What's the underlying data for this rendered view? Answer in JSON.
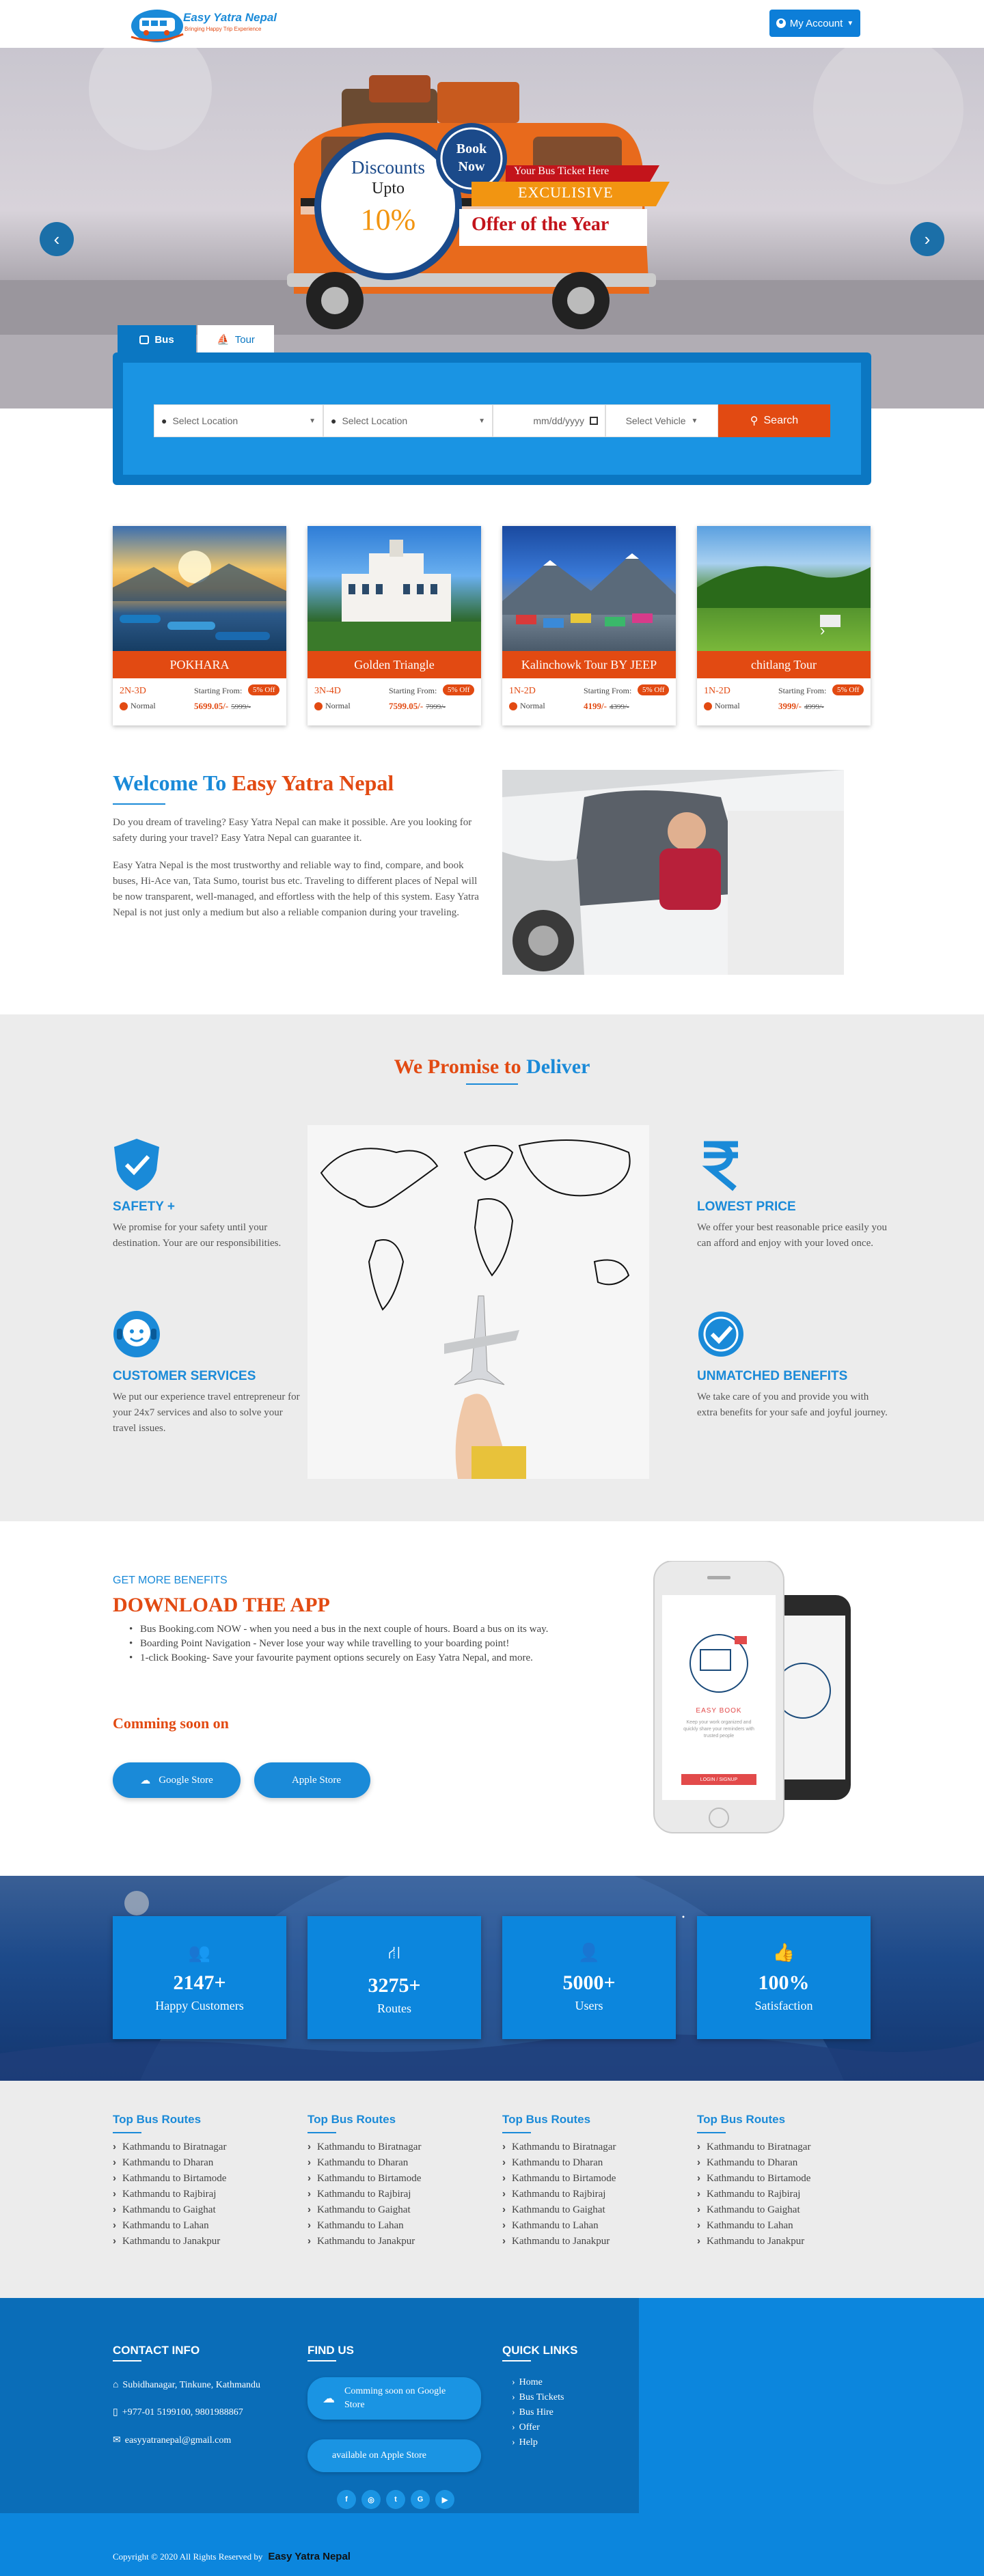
{
  "header": {
    "brand": "Easy Yatra Nepal",
    "tagline": "Bringing Happy Trip Experience",
    "account_label": "My Account"
  },
  "hero": {
    "discount_title": "Discounts",
    "discount_upto": "Upto",
    "discount_value": "10%",
    "book_now_1": "Book",
    "book_now_2": "Now",
    "ribbon_1": "Your Bus Ticket Here",
    "ribbon_2": "EXCULISIVE",
    "ribbon_3": "Offer of the Year"
  },
  "search": {
    "tabs": [
      {
        "label": "Bus"
      },
      {
        "label": "Tour"
      }
    ],
    "from_placeholder": "Select Location",
    "to_placeholder": "Select Location",
    "date_placeholder": "mm/dd/yyyy",
    "vehicle_placeholder": "Select Vehicle",
    "button_label": "Search"
  },
  "tours": [
    {
      "name": "POKHARA",
      "days": "2N-3D",
      "starting": "Starting From:",
      "off": "5% Off",
      "category": "Normal",
      "price": "5699.05/-",
      "old_price": "5999/-"
    },
    {
      "name": "Golden Triangle",
      "days": "3N-4D",
      "starting": "Starting From:",
      "off": "5% Off",
      "category": "Normal",
      "price": "7599.05/-",
      "old_price": "7999/-"
    },
    {
      "name": "Kalinchowk Tour BY JEEP",
      "days": "1N-2D",
      "starting": "Starting From:",
      "off": "5% Off",
      "category": "Normal",
      "price": "4199/-",
      "old_price": "4399/-"
    },
    {
      "name": "chitlang Tour",
      "days": "1N-2D",
      "starting": "Starting From:",
      "off": "5% Off",
      "category": "Normal",
      "price": "3999/-",
      "old_price": "4999/-"
    }
  ],
  "welcome": {
    "title_1": "Welcome To ",
    "title_2": "Easy Yatra Nepal",
    "para_1": "Do you dream of traveling? Easy Yatra Nepal can make it possible. Are you looking for safety during your travel? Easy Yatra Nepal can guarantee it.",
    "para_2": "Easy Yatra Nepal is the most trustworthy and reliable way to find, compare, and book buses, Hi-Ace van, Tata Sumo, tourist bus etc. Traveling to different places of Nepal will be now transparent, well-managed, and effortless with the help of this system. Easy Yatra Nepal is not just only a medium but also a reliable companion during your traveling."
  },
  "promise": {
    "title_1": "We Promise to ",
    "title_2": "Deliver",
    "features": [
      {
        "title": "SAFETY +",
        "text": "We promise for your safety until your destination. Your are our responsibilities."
      },
      {
        "title": "CUSTOMER SERVICES",
        "text": "We put our experience travel entrepreneur for your 24x7 services and also to solve your travel issues."
      },
      {
        "title": "LOWEST PRICE",
        "text": "We offer your best reasonable price easily you can afford and enjoy with your loved once."
      },
      {
        "title": "UNMATCHED BENEFITS",
        "text": "We take care of you and provide you with extra benefits for your safe and joyful journey."
      }
    ]
  },
  "app": {
    "eyebrow": "GET MORE BENEFITS",
    "title": "DOWNLOAD THE APP",
    "bullets": [
      "Bus Booking.com NOW - when you need a bus in the next couple of hours. Board a bus on its way.",
      "Boarding Point Navigation - Never lose your way while travelling to your boarding point!",
      "1-click Booking- Save your favourite payment options securely on Easy Yatra Nepal, and more."
    ],
    "coming_soon": "Comming soon on",
    "google": "Google Store",
    "apple": "Apple Store",
    "phone_title": "EASY BOOK",
    "phone_text": "Keep your work organized and quickly share your reminders with trusted people",
    "phone_btn": "LOGIN / SIGNUP"
  },
  "stats": [
    {
      "num": "2147+",
      "label": "Happy Customers"
    },
    {
      "num": "3275+",
      "label": "Routes"
    },
    {
      "num": "5000+",
      "label": "Users"
    },
    {
      "num": "100%",
      "label": "Satisfaction"
    }
  ],
  "routes": {
    "heading": "Top Bus Routes",
    "items": [
      "Kathmandu to Biratnagar",
      "Kathmandu to Dharan",
      "Kathmandu to Birtamode",
      "Kathmandu to Rajbiraj",
      "Kathmandu to Gaighat",
      "Kathmandu to Lahan",
      "Kathmandu to Janakpur"
    ]
  },
  "footer": {
    "contact_title": "CONTACT INFO",
    "address": "Subidhanagar, Tinkune, Kathmandu",
    "phone": "+977-01 5199100, 9801988867",
    "email": "easyyatranepal@gmail.com",
    "find_title": "FIND US",
    "google_btn": "Comming soon on Google Store",
    "apple_btn": "available on Apple Store",
    "quick_title": "QUICK LINKS",
    "links": [
      "Home",
      "Bus Tickets",
      "Bus Hire",
      "Offer",
      "Help"
    ],
    "copyright": "Copyright © 2020 All Rights Reserved by",
    "copyright_brand": "Easy Yatra Nepal",
    "social": [
      "f",
      "◎",
      "t",
      "G",
      "▶"
    ]
  }
}
